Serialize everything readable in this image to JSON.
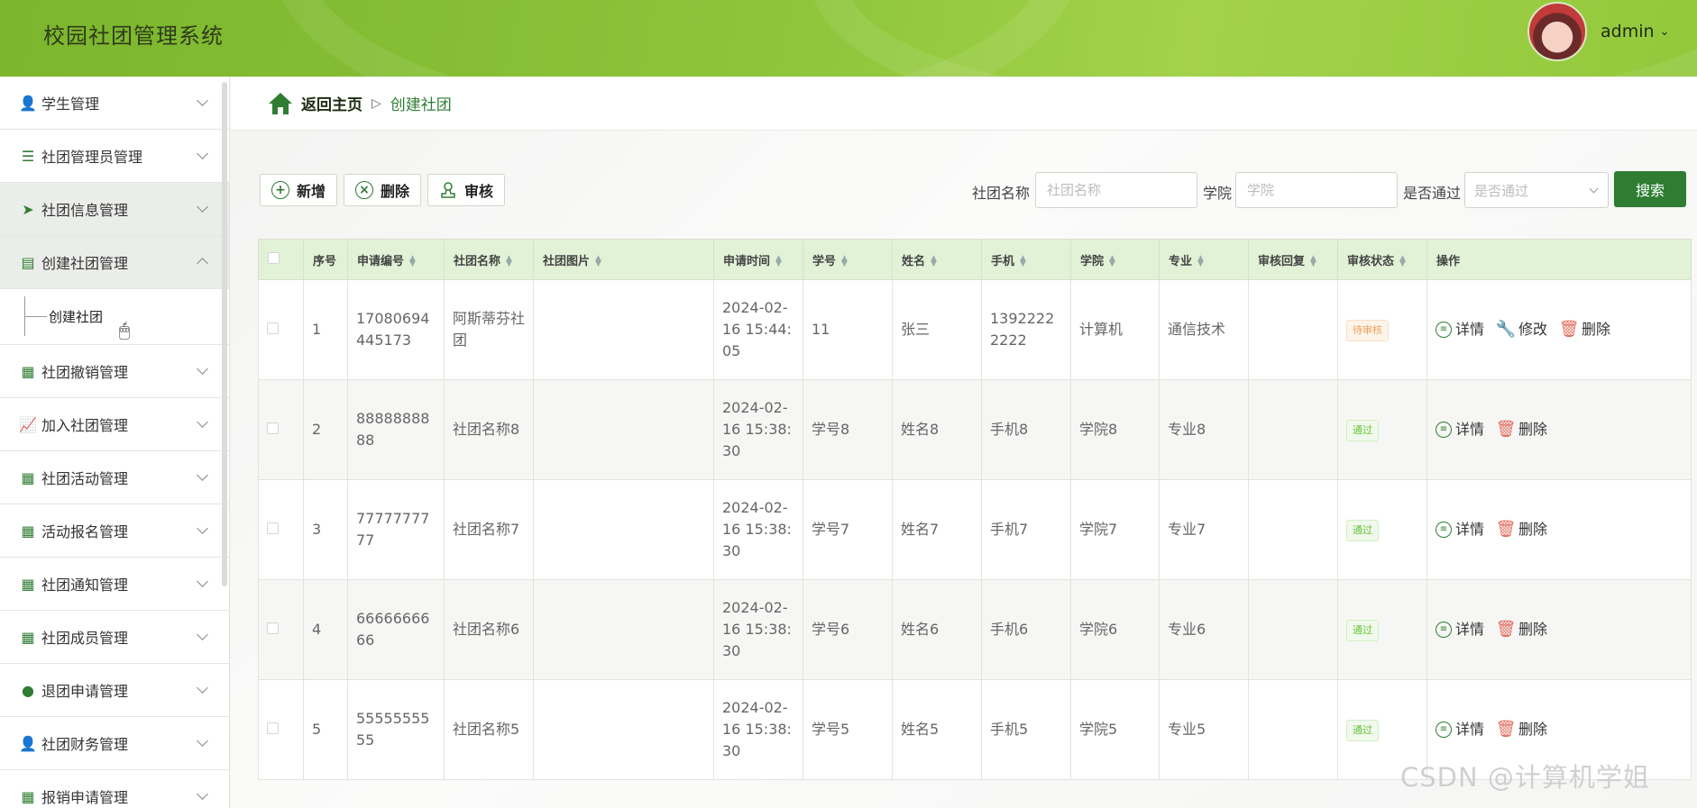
{
  "app": {
    "title": "校园社团管理系统",
    "user": "admin"
  },
  "sidebar": {
    "items": [
      {
        "label": "学生管理",
        "icon": "person-icon",
        "expanded": false
      },
      {
        "label": "社团管理员管理",
        "icon": "list-icon",
        "expanded": false
      },
      {
        "label": "社团信息管理",
        "icon": "paper-plane-icon",
        "expanded": false
      },
      {
        "label": "创建社团管理",
        "icon": "clipboard-icon",
        "expanded": true
      },
      {
        "label": "社团撤销管理",
        "icon": "grid-icon",
        "expanded": false
      },
      {
        "label": "加入社团管理",
        "icon": "chart-icon",
        "expanded": false
      },
      {
        "label": "社团活动管理",
        "icon": "grid-icon",
        "expanded": false
      },
      {
        "label": "活动报名管理",
        "icon": "grid-icon",
        "expanded": false
      },
      {
        "label": "社团通知管理",
        "icon": "grid-9-icon",
        "expanded": false
      },
      {
        "label": "社团成员管理",
        "icon": "grid-icon",
        "expanded": false
      },
      {
        "label": "退团申请管理",
        "icon": "bulb-icon",
        "expanded": false
      },
      {
        "label": "社团财务管理",
        "icon": "person-icon",
        "expanded": false
      },
      {
        "label": "报销申请管理",
        "icon": "grid-icon",
        "expanded": false
      }
    ],
    "subitem": "创建社团"
  },
  "breadcrumb": {
    "home": "返回主页",
    "separator": "▷",
    "current": "创建社团"
  },
  "toolbar": {
    "add": "新增",
    "delete": "删除",
    "audit": "审核"
  },
  "filters": {
    "club_name_label": "社团名称",
    "club_name_placeholder": "社团名称",
    "college_label": "学院",
    "college_placeholder": "学院",
    "passed_label": "是否通过",
    "passed_placeholder": "是否通过",
    "search": "搜索"
  },
  "table": {
    "headers": [
      "序号",
      "申请编号",
      "社团名称",
      "社团图片",
      "申请时间",
      "学号",
      "姓名",
      "手机",
      "学院",
      "专业",
      "审核回复",
      "审核状态",
      "操作"
    ],
    "rows": [
      {
        "no": "1",
        "app_id": "17080694445173",
        "name": "阿斯蒂芬社团",
        "image": "",
        "time": "2024-02-16 15:44:05",
        "student_id": "11",
        "student_name": "张三",
        "phone": "13922222222",
        "college": "计算机",
        "major": "通信技术",
        "reply": "",
        "status": "待审核",
        "status_type": "pending",
        "ops": [
          "详情",
          "修改",
          "删除"
        ]
      },
      {
        "no": "2",
        "app_id": "8888888888",
        "name": "社团名称8",
        "image": "",
        "time": "2024-02-16 15:38:30",
        "student_id": "学号8",
        "student_name": "姓名8",
        "phone": "手机8",
        "college": "学院8",
        "major": "专业8",
        "reply": "",
        "status": "通过",
        "status_type": "pass",
        "ops": [
          "详情",
          "删除"
        ]
      },
      {
        "no": "3",
        "app_id": "7777777777",
        "name": "社团名称7",
        "image": "",
        "time": "2024-02-16 15:38:30",
        "student_id": "学号7",
        "student_name": "姓名7",
        "phone": "手机7",
        "college": "学院7",
        "major": "专业7",
        "reply": "",
        "status": "通过",
        "status_type": "pass",
        "ops": [
          "详情",
          "删除"
        ]
      },
      {
        "no": "4",
        "app_id": "6666666666",
        "name": "社团名称6",
        "image": "",
        "time": "2024-02-16 15:38:30",
        "student_id": "学号6",
        "student_name": "姓名6",
        "phone": "手机6",
        "college": "学院6",
        "major": "专业6",
        "reply": "",
        "status": "通过",
        "status_type": "pass",
        "ops": [
          "详情",
          "删除"
        ]
      },
      {
        "no": "5",
        "app_id": "5555555555",
        "name": "社团名称5",
        "image": "",
        "time": "2024-02-16 15:38:30",
        "student_id": "学号5",
        "student_name": "姓名5",
        "phone": "手机5",
        "college": "学院5",
        "major": "专业5",
        "reply": "",
        "status": "通过",
        "status_type": "pass",
        "ops": [
          "详情",
          "删除"
        ]
      }
    ]
  },
  "watermark": "CSDN @计算机学姐",
  "colors": {
    "accent": "#2e7d32",
    "header_green": "#8cc43a",
    "table_head": "#e1f2d6"
  }
}
